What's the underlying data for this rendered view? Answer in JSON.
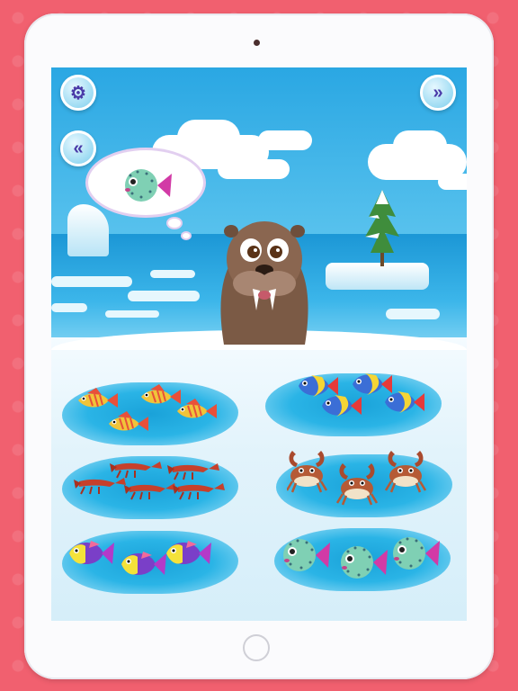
{
  "colors": {
    "frame_bg": "#f1606f",
    "tablet": "#fbfbfd",
    "water": "#2ab4e6",
    "button_icon": "#4a3aa8"
  },
  "toolbar": {
    "settings_icon": "gear-icon",
    "back_icon": "double-chevron-left-icon",
    "next_icon": "double-chevron-right-icon"
  },
  "thought_bubble": {
    "wanted_item": "pufferfish"
  },
  "character": "walrus",
  "ice_holes": [
    {
      "item": "yellow-fish",
      "count": 4
    },
    {
      "item": "tropical-fish",
      "count": 4
    },
    {
      "item": "lobster",
      "count": 4
    },
    {
      "item": "crab",
      "count": 3
    },
    {
      "item": "purple-fish",
      "count": 3
    },
    {
      "item": "pufferfish",
      "count": 3
    }
  ]
}
